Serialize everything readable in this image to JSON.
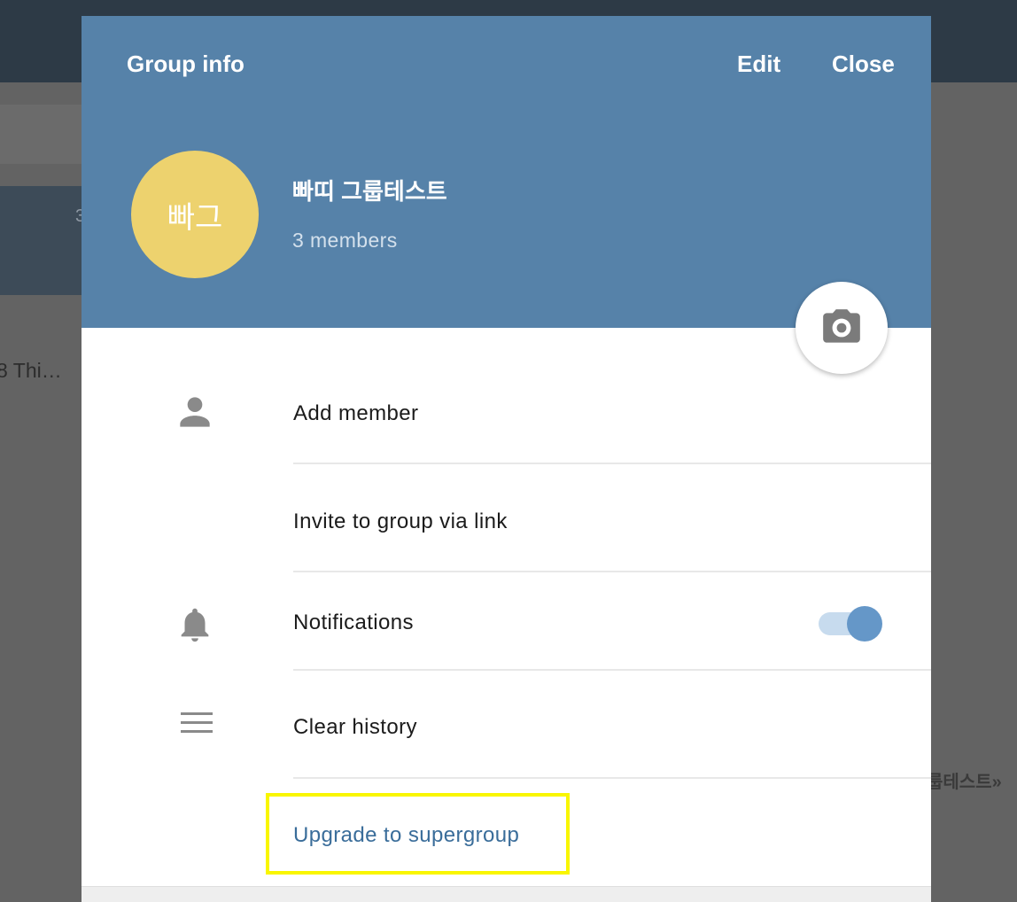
{
  "background": {
    "left_badge": "3",
    "chat_preview": "8 Thi…",
    "right_text": "룹테스트»"
  },
  "modal": {
    "title": "Group info",
    "edit_label": "Edit",
    "close_label": "Close",
    "group": {
      "avatar_initials": "빠그",
      "name": "빠띠 그룹테스트",
      "members": "3 members"
    },
    "photo_button_icon": "camera-icon",
    "actions": [
      {
        "label": "Add member",
        "icon": "person-icon"
      },
      {
        "label": "Invite to group via link"
      },
      {
        "label": "Notifications",
        "icon": "bell-icon",
        "toggle": true
      },
      {
        "label": "Clear history",
        "icon": "menu-icon"
      },
      {
        "label": "Upgrade to supergroup"
      }
    ],
    "notifications_enabled": true
  },
  "colors": {
    "header": "#5682a9",
    "avatar": "#edd26e",
    "link": "#3a6d9a",
    "toggle_track": "#c7dbee",
    "toggle_knob": "#6597c8",
    "highlight": "#f9f600"
  }
}
